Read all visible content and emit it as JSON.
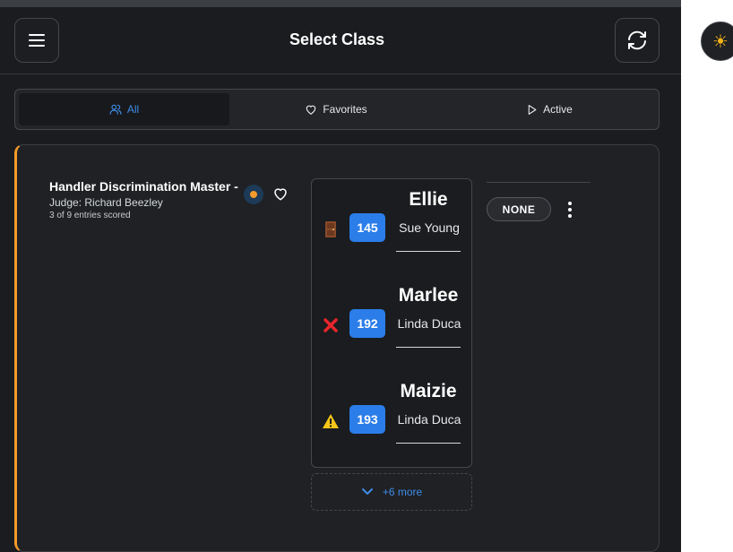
{
  "header": {
    "title": "Select Class",
    "menu_icon": "hamburger-menu-icon",
    "refresh_icon": "refresh-icon"
  },
  "tabs": [
    {
      "label": "All",
      "icon": "users-icon",
      "active": true
    },
    {
      "label": "Favorites",
      "icon": "heart-icon",
      "active": false
    },
    {
      "label": "Active",
      "icon": "play-icon",
      "active": false
    }
  ],
  "class_card": {
    "name": "Handler Discrimination Master -",
    "judge": "Judge: Richard Beezley",
    "entries_scored": "3 of 9 entries scored",
    "accent_color": "#f39a2b",
    "entries": [
      {
        "dog": "Ellie",
        "handler": "Sue Young",
        "armband": "145",
        "status_icon": "door-icon"
      },
      {
        "dog": "Marlee",
        "handler": "Linda Duca",
        "armband": "192",
        "status_icon": "red-x-icon"
      },
      {
        "dog": "Maizie",
        "handler": "Linda Duca",
        "armband": "193",
        "status_icon": "warning-icon"
      }
    ],
    "more_label": "+6 more",
    "status_badge": "NONE"
  },
  "theme_toggle_icon": "sun-icon",
  "colors": {
    "accent_blue": "#2b7de9",
    "link_blue": "#3f8ce8",
    "status_orange": "#f39a2b"
  }
}
